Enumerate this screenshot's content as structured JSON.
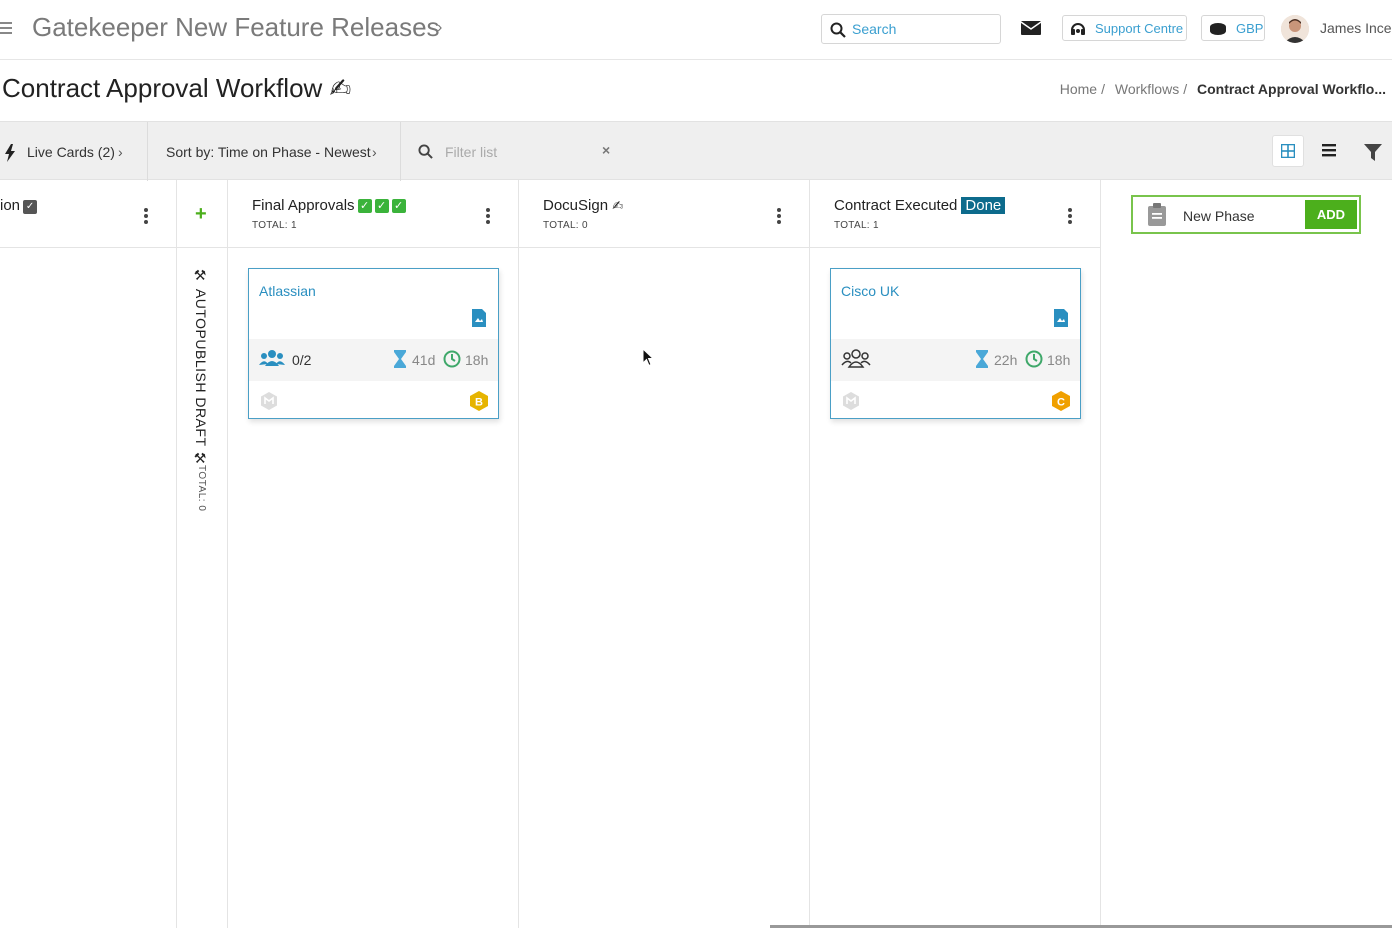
{
  "topbar": {
    "app_title": "Gatekeeper New Feature Releases",
    "search_placeholder": "Search",
    "support_label": "Support Centre",
    "currency_label": "GBP",
    "user_name": "James Ince"
  },
  "page": {
    "title": "Contract Approval Workflow ✍",
    "breadcrumb": [
      "Home",
      "Workflows",
      "Contract Approval Workflo..."
    ]
  },
  "toolbar": {
    "live_cards": "Live Cards (2)",
    "sort": "Sort by: Time on Phase - Newest",
    "filter_placeholder": "Filter list",
    "clear": "×"
  },
  "phases": {
    "partial": {
      "name": "ion"
    },
    "autopublish": {
      "name": "AUTOPUBLISH DRAFT",
      "total": "TOTAL: 0"
    },
    "final_approvals": {
      "name": "Final Approvals",
      "total": "TOTAL: 1"
    },
    "docusign": {
      "name": "DocuSign",
      "total": "TOTAL: 0"
    },
    "contract_executed": {
      "name": "Contract Executed",
      "badge": "Done",
      "total": "TOTAL: 1"
    }
  },
  "cards": [
    {
      "name": "Atlassian",
      "approvers": "0/2",
      "time_on_phase": "41d",
      "time_remaining": "18h",
      "grade": "B",
      "grade_color": "#e6b400"
    },
    {
      "name": "Cisco UK",
      "approvers": "",
      "time_on_phase": "22h",
      "time_remaining": "18h",
      "grade": "C",
      "grade_color": "#f0a000"
    }
  ],
  "new_phase": {
    "placeholder": "New Phase",
    "add_label": "ADD"
  },
  "colors": {
    "accent": "#3a9fd0",
    "green": "#4caf1c",
    "done": "#0d6b8c"
  }
}
